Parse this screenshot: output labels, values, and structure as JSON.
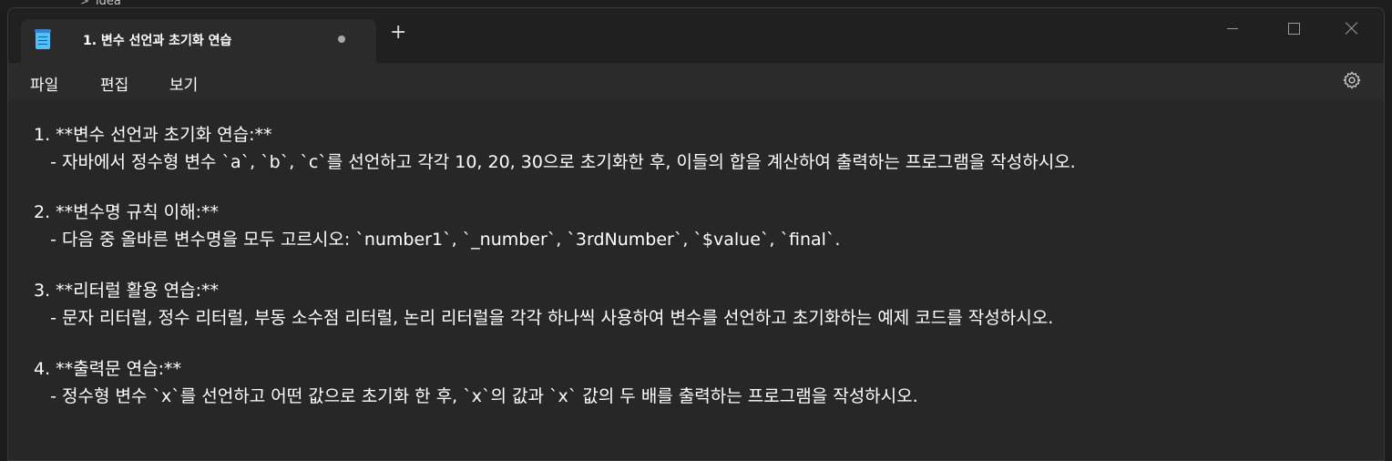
{
  "background_window": {
    "text": "idea",
    "chevron": ">"
  },
  "tab": {
    "title": "1. 변수 선언과 초기화 연습",
    "new_tab_label": "+"
  },
  "window_controls": {
    "minimize": "minimize-icon",
    "maximize": "maximize-icon",
    "close": "close-icon"
  },
  "menu": {
    "file": "파일",
    "edit": "편집",
    "view": "보기"
  },
  "editor": {
    "lines": [
      "1. **변수 선언과 초기화 연습:**",
      "   - 자바에서 정수형 변수 `a`, `b`, `c`를 선언하고 각각 10, 20, 30으로 초기화한 후, 이들의 합을 계산하여 출력하는 프로그램을 작성하시오.",
      "2. **변수명 규칙 이해:**",
      "   - 다음 중 올바른 변수명을 모두 고르시오: `number1`, `_number`, `3rdNumber`, `$value`, `final`.",
      "3. **리터럴 활용 연습:**",
      "   - 문자 리터럴, 정수 리터럴, 부동 소수점 리터럴, 논리 리터럴을 각각 하나씩 사용하여 변수를 선언하고 초기화하는 예제 코드를 작성하시오.",
      "4. **출력문 연습:**",
      "   - 정수형 변수 `x`를 선언하고 어떤 값으로 초기화 한 후, `x`의 값과 `x` 값의 두 배를 출력하는 프로그램을 작성하시오."
    ]
  },
  "colors": {
    "accent": "#4cc2ff",
    "background": "#272727",
    "titlebar": "#202020",
    "text": "#ffffff"
  }
}
